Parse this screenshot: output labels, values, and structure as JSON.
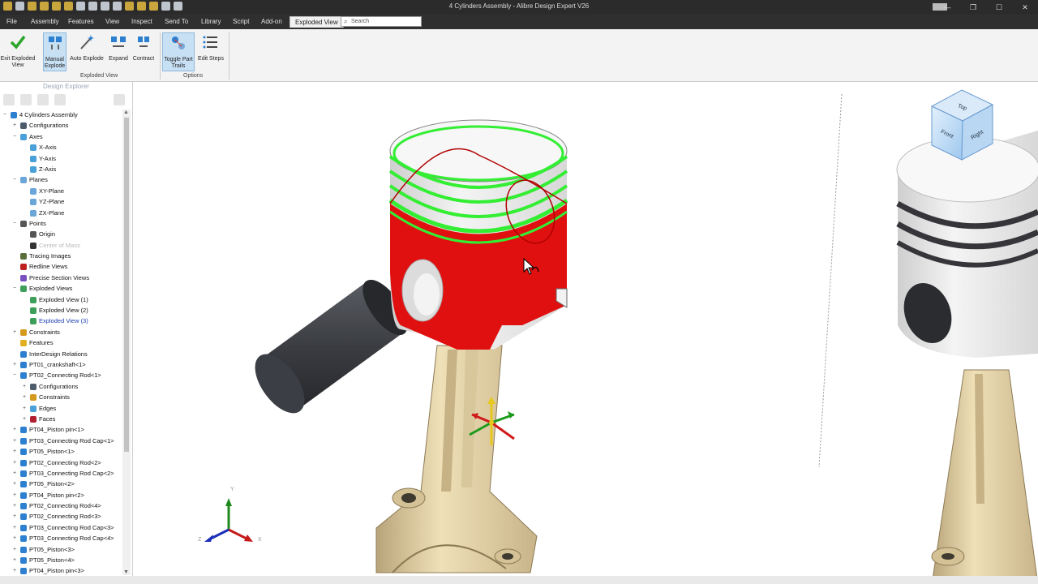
{
  "app": {
    "title": "4 Cylinders Assembly - Alibre Design Expert V26",
    "window_controls": [
      "—",
      "❐",
      "☐",
      "✕"
    ]
  },
  "menu": {
    "items": [
      "File",
      "Assembly",
      "Features",
      "View",
      "Inspect",
      "Send To",
      "Library",
      "Script",
      "Add-on",
      "Exploded View"
    ],
    "active": "Exploded View",
    "search_placeholder": "Search"
  },
  "ribbon": {
    "buttons": [
      {
        "label1": "Exit Exploded",
        "label2": "View",
        "icon": "checkmark-icon"
      },
      {
        "label1": "Manual",
        "label2": "Explode",
        "icon": "manual-explode-icon",
        "selected": true
      },
      {
        "label1": "Auto Explode",
        "label2": "",
        "icon": "magic-wand-icon"
      },
      {
        "label1": "Expand",
        "label2": "",
        "icon": "expand-icon"
      },
      {
        "label1": "Contract",
        "label2": "",
        "icon": "contract-icon"
      },
      {
        "label1": "Toggle Part",
        "label2": "Trails",
        "icon": "trails-icon",
        "selected": true
      },
      {
        "label1": "Edit Steps",
        "label2": "",
        "icon": "steps-list-icon"
      }
    ],
    "groups": [
      "Exploded View",
      "Options"
    ]
  },
  "explorer": {
    "title": "Design Explorer",
    "tree": [
      {
        "label": "4 Cylinders Assembly",
        "level": 0,
        "toggle": "−",
        "icon": "assembly-icon"
      },
      {
        "label": "Configurations",
        "level": 1,
        "toggle": "+",
        "icon": "config-icon"
      },
      {
        "label": "Axes",
        "level": 1,
        "toggle": "−",
        "icon": "axes-icon"
      },
      {
        "label": "X-Axis",
        "level": 2,
        "toggle": "",
        "icon": "axis-icon"
      },
      {
        "label": "Y-Axis",
        "level": 2,
        "toggle": "",
        "icon": "axis-icon"
      },
      {
        "label": "Z-Axis",
        "level": 2,
        "toggle": "",
        "icon": "axis-icon"
      },
      {
        "label": "Planes",
        "level": 1,
        "toggle": "−",
        "icon": "plane-icon"
      },
      {
        "label": "XY-Plane",
        "level": 2,
        "toggle": "",
        "icon": "plane-icon"
      },
      {
        "label": "YZ-Plane",
        "level": 2,
        "toggle": "",
        "icon": "plane-icon"
      },
      {
        "label": "ZX-Plane",
        "level": 2,
        "toggle": "",
        "icon": "plane-icon"
      },
      {
        "label": "Points",
        "level": 1,
        "toggle": "−",
        "icon": "point-icon"
      },
      {
        "label": "Origin",
        "level": 2,
        "toggle": "",
        "icon": "point-icon"
      },
      {
        "label": "Center of Mass",
        "level": 2,
        "toggle": "",
        "icon": "mass-icon",
        "dim": true
      },
      {
        "label": "Tracing Images",
        "level": 1,
        "toggle": "",
        "icon": "image-icon"
      },
      {
        "label": "Redline Views",
        "level": 1,
        "toggle": "",
        "icon": "redline-icon"
      },
      {
        "label": "Precise Section Views",
        "level": 1,
        "toggle": "",
        "icon": "section-icon"
      },
      {
        "label": "Exploded Views",
        "level": 1,
        "toggle": "−",
        "icon": "exploded-icon"
      },
      {
        "label": "Exploded View (1)",
        "level": 2,
        "toggle": "",
        "icon": "exploded-icon"
      },
      {
        "label": "Exploded View (2)",
        "level": 2,
        "toggle": "",
        "icon": "exploded-icon"
      },
      {
        "label": "Exploded View (3)",
        "level": 2,
        "toggle": "",
        "icon": "exploded-icon",
        "active": true
      },
      {
        "label": "Constraints",
        "level": 1,
        "toggle": "+",
        "icon": "constraint-icon"
      },
      {
        "label": "Features",
        "level": 1,
        "toggle": "",
        "icon": "feature-icon"
      },
      {
        "label": "InterDesign Relations",
        "level": 1,
        "toggle": "",
        "icon": "relation-icon"
      },
      {
        "label": "PT01_crankshaft<1>",
        "level": 1,
        "toggle": "+",
        "icon": "part-icon"
      },
      {
        "label": "PT02_Connecting Rod<1>",
        "level": 1,
        "toggle": "−",
        "icon": "part-icon"
      },
      {
        "label": "Configurations",
        "level": 2,
        "toggle": "+",
        "icon": "config-icon"
      },
      {
        "label": "Constraints",
        "level": 2,
        "toggle": "+",
        "icon": "constraint-icon"
      },
      {
        "label": "Edges",
        "level": 2,
        "toggle": "+",
        "icon": "edge-icon"
      },
      {
        "label": "Faces",
        "level": 2,
        "toggle": "+",
        "icon": "face-icon"
      },
      {
        "label": "PT04_Piston pin<1>",
        "level": 1,
        "toggle": "+",
        "icon": "part-icon"
      },
      {
        "label": "PT03_Connecting Rod Cap<1>",
        "level": 1,
        "toggle": "+",
        "icon": "part-icon"
      },
      {
        "label": "PT05_Piston<1>",
        "level": 1,
        "toggle": "+",
        "icon": "part-icon"
      },
      {
        "label": "PT02_Connecting Rod<2>",
        "level": 1,
        "toggle": "+",
        "icon": "part-icon"
      },
      {
        "label": "PT03_Connecting Rod Cap<2>",
        "level": 1,
        "toggle": "+",
        "icon": "part-icon"
      },
      {
        "label": "PT05_Piston<2>",
        "level": 1,
        "toggle": "+",
        "icon": "part-icon"
      },
      {
        "label": "PT04_Piston pin<2>",
        "level": 1,
        "toggle": "+",
        "icon": "part-icon"
      },
      {
        "label": "PT02_Connecting Rod<4>",
        "level": 1,
        "toggle": "+",
        "icon": "part-icon"
      },
      {
        "label": "PT02_Connecting Rod<3>",
        "level": 1,
        "toggle": "+",
        "icon": "part-icon"
      },
      {
        "label": "PT03_Connecting Rod Cap<3>",
        "level": 1,
        "toggle": "+",
        "icon": "part-icon"
      },
      {
        "label": "PT03_Connecting Rod Cap<4>",
        "level": 1,
        "toggle": "+",
        "icon": "part-icon"
      },
      {
        "label": "PT05_Piston<3>",
        "level": 1,
        "toggle": "+",
        "icon": "part-icon"
      },
      {
        "label": "PT05_Piston<4>",
        "level": 1,
        "toggle": "+",
        "icon": "part-icon"
      },
      {
        "label": "PT04_Piston pin<3>",
        "level": 1,
        "toggle": "+",
        "icon": "part-icon"
      }
    ]
  },
  "viewcube": {
    "top": "Top",
    "front": "Front",
    "right": "Right"
  },
  "triad": {
    "x": "X",
    "y": "Y",
    "z": "Z"
  },
  "colors": {
    "selected_part": "#e01010",
    "ring_highlight": "#33ee33",
    "rod": "#e6d3a4",
    "pin": "#3a3c40",
    "ribbon_selected": "#c8e0f4"
  }
}
